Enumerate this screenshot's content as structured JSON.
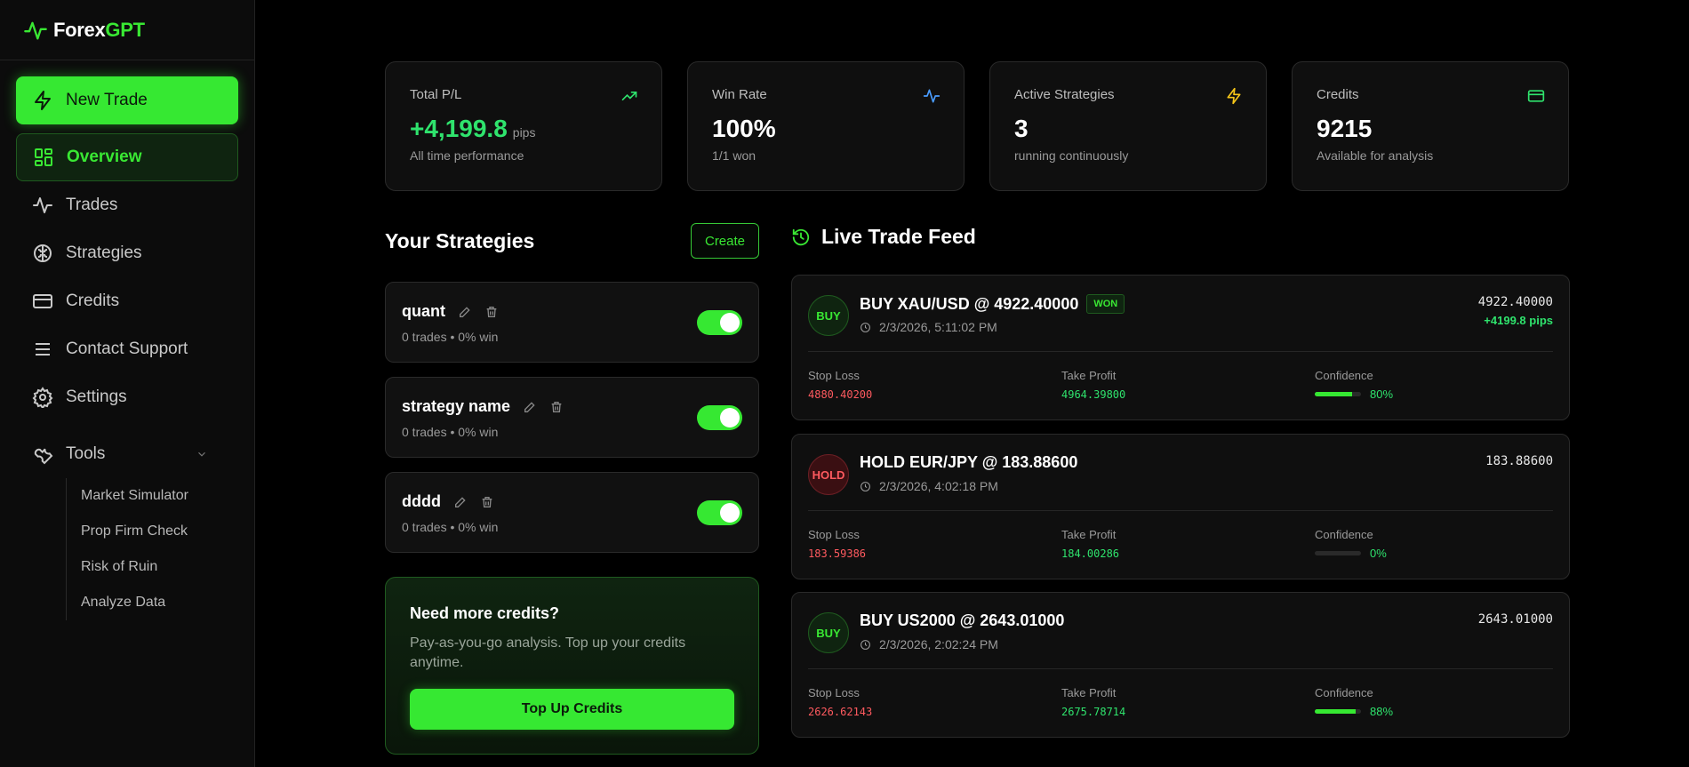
{
  "brand": {
    "prefix": "Forex",
    "suffix": "GPT"
  },
  "sidebar": {
    "new_trade": "New Trade",
    "items": [
      {
        "label": "Overview",
        "icon": "grid-icon",
        "active": true
      },
      {
        "label": "Trades",
        "icon": "activity-icon"
      },
      {
        "label": "Strategies",
        "icon": "brain-icon"
      },
      {
        "label": "Credits",
        "icon": "credit-card-icon"
      },
      {
        "label": "Contact Support",
        "icon": "menu-icon"
      },
      {
        "label": "Settings",
        "icon": "gear-icon"
      }
    ],
    "tools": {
      "label": "Tools",
      "items": [
        "Market Simulator",
        "Prop Firm Check",
        "Risk of Ruin",
        "Analyze Data"
      ]
    }
  },
  "stats": [
    {
      "label": "Total P/L",
      "value": "+4,199.8",
      "unit": "pips",
      "sub": "All time performance",
      "icon": "trending-up-icon",
      "color": "#2fe36d"
    },
    {
      "label": "Win Rate",
      "value": "100%",
      "sub": "1/1 won",
      "icon": "activity-icon",
      "color": "#4a9cff"
    },
    {
      "label": "Active Strategies",
      "value": "3",
      "sub": "running continuously",
      "icon": "zap-icon",
      "color": "#f5c518"
    },
    {
      "label": "Credits",
      "value": "9215",
      "sub": "Available for analysis",
      "icon": "credit-card-icon",
      "color": "#2fe36d"
    }
  ],
  "strategies": {
    "title": "Your Strategies",
    "create_label": "Create",
    "items": [
      {
        "name": "quant",
        "meta": "0 trades • 0% win",
        "enabled": true
      },
      {
        "name": "strategy name",
        "meta": "0 trades • 0% win",
        "enabled": true
      },
      {
        "name": "dddd",
        "meta": "0 trades • 0% win",
        "enabled": true
      }
    ]
  },
  "credits_promo": {
    "title": "Need more credits?",
    "text": "Pay-as-you-go analysis. Top up your credits anytime.",
    "button": "Top Up Credits"
  },
  "feed": {
    "title": "Live Trade Feed",
    "labels": {
      "sl": "Stop Loss",
      "tp": "Take Profit",
      "conf": "Confidence"
    },
    "trades": [
      {
        "action": "BUY",
        "title": "BUY XAU/USD @ 4922.40000",
        "badge": "WON",
        "time": "2/3/2026, 5:11:02 PM",
        "price": "4922.40000",
        "pips": "+4199.8 pips",
        "sl": "4880.40200",
        "tp": "4964.39800",
        "confidence": "80%",
        "confidence_value": 80
      },
      {
        "action": "HOLD",
        "title": "HOLD EUR/JPY @ 183.88600",
        "badge": "",
        "time": "2/3/2026, 4:02:18 PM",
        "price": "183.88600",
        "pips": "",
        "sl": "183.59386",
        "tp": "184.00286",
        "confidence": "0%",
        "confidence_value": 0
      },
      {
        "action": "BUY",
        "title": "BUY US2000 @ 2643.01000",
        "badge": "",
        "time": "2/3/2026, 2:02:24 PM",
        "price": "2643.01000",
        "pips": "",
        "sl": "2626.62143",
        "tp": "2675.78714",
        "confidence": "88%",
        "confidence_value": 88
      }
    ]
  }
}
